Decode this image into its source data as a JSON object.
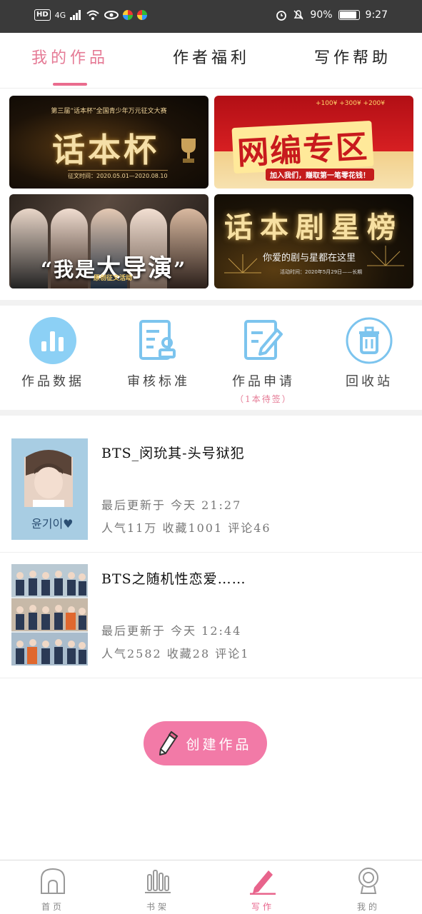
{
  "status_bar": {
    "hd": "HD",
    "network": "4G",
    "battery": "90%",
    "battery_level": 0.9,
    "time": "9:27"
  },
  "tabs": [
    {
      "label": "我的作品",
      "active": true
    },
    {
      "label": "作者福利",
      "active": false
    },
    {
      "label": "写作帮助",
      "active": false
    }
  ],
  "banners": {
    "b1": {
      "top": "第三届“话本杯”全国青少年万元征文大赛",
      "title": "话本杯",
      "date": "征文时间：2020.05.01—2020.08.10"
    },
    "b2": {
      "prices": "+100¥  +300¥  +200¥",
      "title": "网编专区",
      "sub": "加入我们，赚取第一笔零花钱！"
    },
    "b3": {
      "title_pre": "“我是",
      "title_big": "大导演",
      "title_post": "”",
      "sub": "原创征文活动"
    },
    "b4": {
      "title": "话本剧星榜",
      "sub": "你爱的剧与星都在这里",
      "date": "活动时间：2020年5月29日——长期"
    }
  },
  "quick": [
    {
      "label": "作品数据",
      "icon": "bar-chart-icon",
      "note": ""
    },
    {
      "label": "审核标准",
      "icon": "review-standard-icon",
      "note": ""
    },
    {
      "label": "作品申请",
      "icon": "edit-document-icon",
      "note": "（1本待签）"
    },
    {
      "label": "回收站",
      "icon": "trash-icon",
      "note": ""
    }
  ],
  "works": [
    {
      "title": "BTS_闵玧其-头号狱犯",
      "updated": "最后更新于 今天 21:27",
      "stats": "人气11万 收藏1001 评论46",
      "cover_text": "윤기이♥"
    },
    {
      "title": "BTS之随机性恋爱……",
      "updated": "最后更新于 今天 12:44",
      "stats": "人气2582 收藏28 评论1"
    }
  ],
  "create_button": {
    "label": "创建作品"
  },
  "bottom_nav": [
    {
      "label": "首页",
      "icon": "home-icon",
      "active": false
    },
    {
      "label": "书架",
      "icon": "bookshelf-icon",
      "active": false
    },
    {
      "label": "写作",
      "icon": "pen-icon",
      "active": true
    },
    {
      "label": "我的",
      "icon": "profile-icon",
      "active": false
    }
  ],
  "colors": {
    "accent": "#e57a95",
    "button": "#f27aa7",
    "icon_blue": "#7cc4ee"
  }
}
